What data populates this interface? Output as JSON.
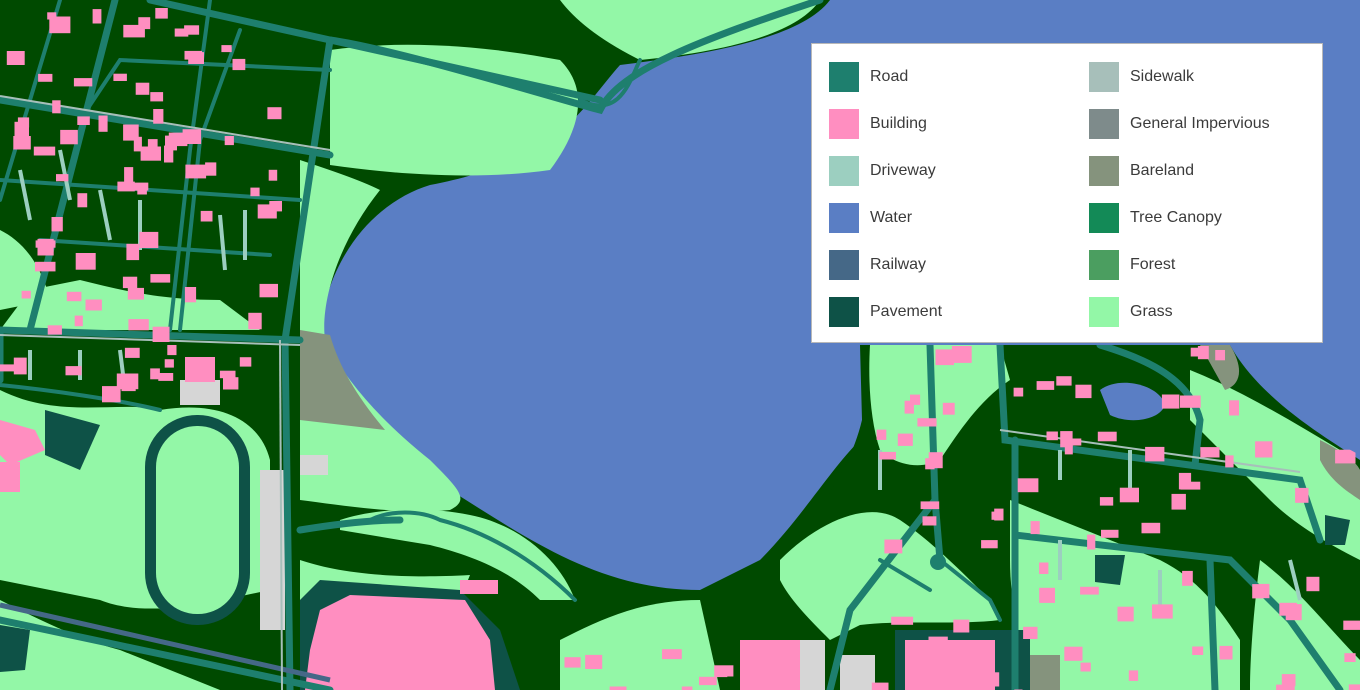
{
  "legend": {
    "items": [
      {
        "label": "Road",
        "color": "#1e7f6e"
      },
      {
        "label": "Building",
        "color": "#ff8ec0"
      },
      {
        "label": "Driveway",
        "color": "#9ccfc0"
      },
      {
        "label": "Water",
        "color": "#5a7ec4"
      },
      {
        "label": "Railway",
        "color": "#456887"
      },
      {
        "label": "Pavement",
        "color": "#0e5247"
      },
      {
        "label": "Sidewalk",
        "color": "#a7bfba"
      },
      {
        "label": "General Impervious",
        "color": "#7e8b8b"
      },
      {
        "label": "Bareland",
        "color": "#85937d"
      },
      {
        "label": "Tree Canopy",
        "color": "#138a57"
      },
      {
        "label": "Forest",
        "color": "#4b9e60"
      },
      {
        "label": "Grass",
        "color": "#93f7a7"
      }
    ]
  },
  "map_colors": {
    "forest": "#004a00",
    "grass": "#93f7a7",
    "road": "#1e7f6e",
    "building": "#ff8ec0",
    "water": "#5a7ec4",
    "pavement": "#0e5247",
    "driveway": "#9ccfc0",
    "sidewalk": "#a7bfba",
    "impervious": "#d6d6d6",
    "bareland": "#85937d",
    "railway": "#456887"
  }
}
